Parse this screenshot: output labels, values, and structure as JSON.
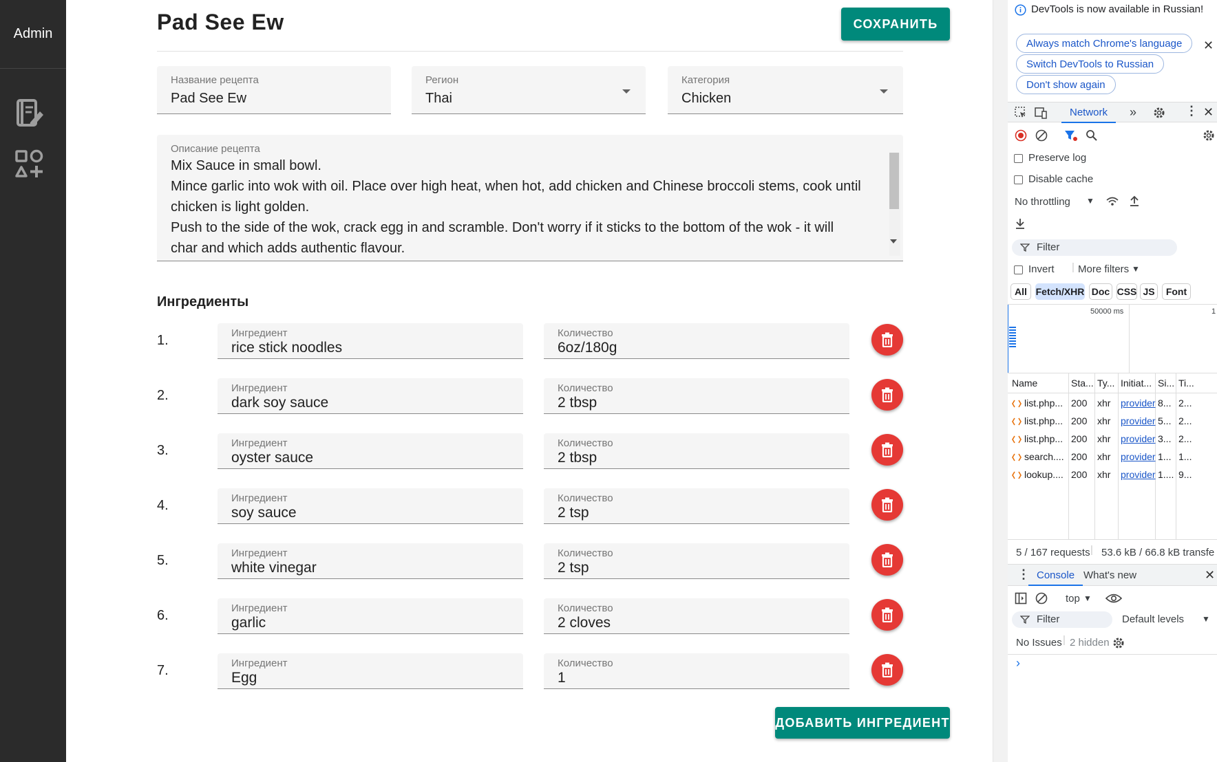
{
  "sidebar": {
    "brand": "Admin",
    "icons": [
      "recipe-book-edit-icon",
      "add-category-icon"
    ]
  },
  "recipe": {
    "title": "Pad See Ew",
    "save_label": "Сохранить",
    "name_label": "Название рецепта",
    "name_value": "Pad See Ew",
    "region_label": "Регион",
    "region_value": "Thai",
    "category_label": "Категория",
    "category_value": "Chicken",
    "description_label": "Описание рецепта",
    "description_lines": [
      "Mix Sauce in small bowl.",
      "Mince garlic into wok with oil. Place over high heat, when hot, add chicken and Chinese broccoli stems, cook until",
      "chicken is light golden.",
      "Push to the side of the wok, crack egg in and scramble. Don't worry if it sticks to the bottom of the wok - it will",
      "char and which adds authentic flavour."
    ],
    "ingredients_title": "Ингредиенты",
    "ingredient_label": "Ингредиент",
    "quantity_label": "Количество",
    "ingredients": [
      {
        "num": "1.",
        "name": "rice stick noodles",
        "qty": "6oz/180g"
      },
      {
        "num": "2.",
        "name": "dark soy sauce",
        "qty": "2 tbsp"
      },
      {
        "num": "3.",
        "name": "oyster sauce",
        "qty": "2 tbsp"
      },
      {
        "num": "4.",
        "name": "soy sauce",
        "qty": "2 tsp"
      },
      {
        "num": "5.",
        "name": "white vinegar",
        "qty": "2 tsp"
      },
      {
        "num": "6.",
        "name": "garlic",
        "qty": "2 cloves"
      },
      {
        "num": "7.",
        "name": "Egg",
        "qty": "1"
      }
    ],
    "add_ingredient_label": "Добавить ингредиент"
  },
  "devtools": {
    "info_text": "DevTools is now available in Russian!",
    "pill_match": "Always match Chrome's language",
    "pill_switch": "Switch DevTools to Russian",
    "pill_dont_show": "Don't show again",
    "tab_network": "Network",
    "preserve_log": "Preserve log",
    "disable_cache": "Disable cache",
    "throttling": "No throttling",
    "filter_placeholder": "Filter",
    "invert": "Invert",
    "more_filters": "More filters",
    "type_chips": [
      "All",
      "Fetch/XHR",
      "Doc",
      "CSS",
      "JS",
      "Font"
    ],
    "timeline_label": "50000 ms",
    "timeline_label_2": "1",
    "columns": [
      "Name",
      "Sta...",
      "Ty...",
      "Initiat...",
      "Si...",
      "Ti..."
    ],
    "requests": [
      {
        "name": "list.php...",
        "status": "200",
        "type": "xhr",
        "initiator": "provider",
        "size": "8...",
        "time": "2..."
      },
      {
        "name": "list.php...",
        "status": "200",
        "type": "xhr",
        "initiator": "provider",
        "size": "5...",
        "time": "2..."
      },
      {
        "name": "list.php...",
        "status": "200",
        "type": "xhr",
        "initiator": "provider",
        "size": "3...",
        "time": "2..."
      },
      {
        "name": "search....",
        "status": "200",
        "type": "xhr",
        "initiator": "provider",
        "size": "1...",
        "time": "1..."
      },
      {
        "name": "lookup....",
        "status": "200",
        "type": "xhr",
        "initiator": "provider",
        "size": "1....",
        "time": "9..."
      }
    ],
    "summary_requests": "5 / 167 requests",
    "summary_transfer": "53.6 kB / 66.8 kB transfe",
    "console_tab": "Console",
    "whats_new_tab": "What's new",
    "context": "top",
    "console_filter": "Filter",
    "levels": "Default levels",
    "no_issues": "No Issues",
    "hidden": "2 hidden",
    "prompt": "›"
  },
  "colors": {
    "sidebar": "#2b2b2b",
    "accent": "#00897b",
    "danger": "#e53935",
    "devtools_blue": "#1a73e8"
  }
}
